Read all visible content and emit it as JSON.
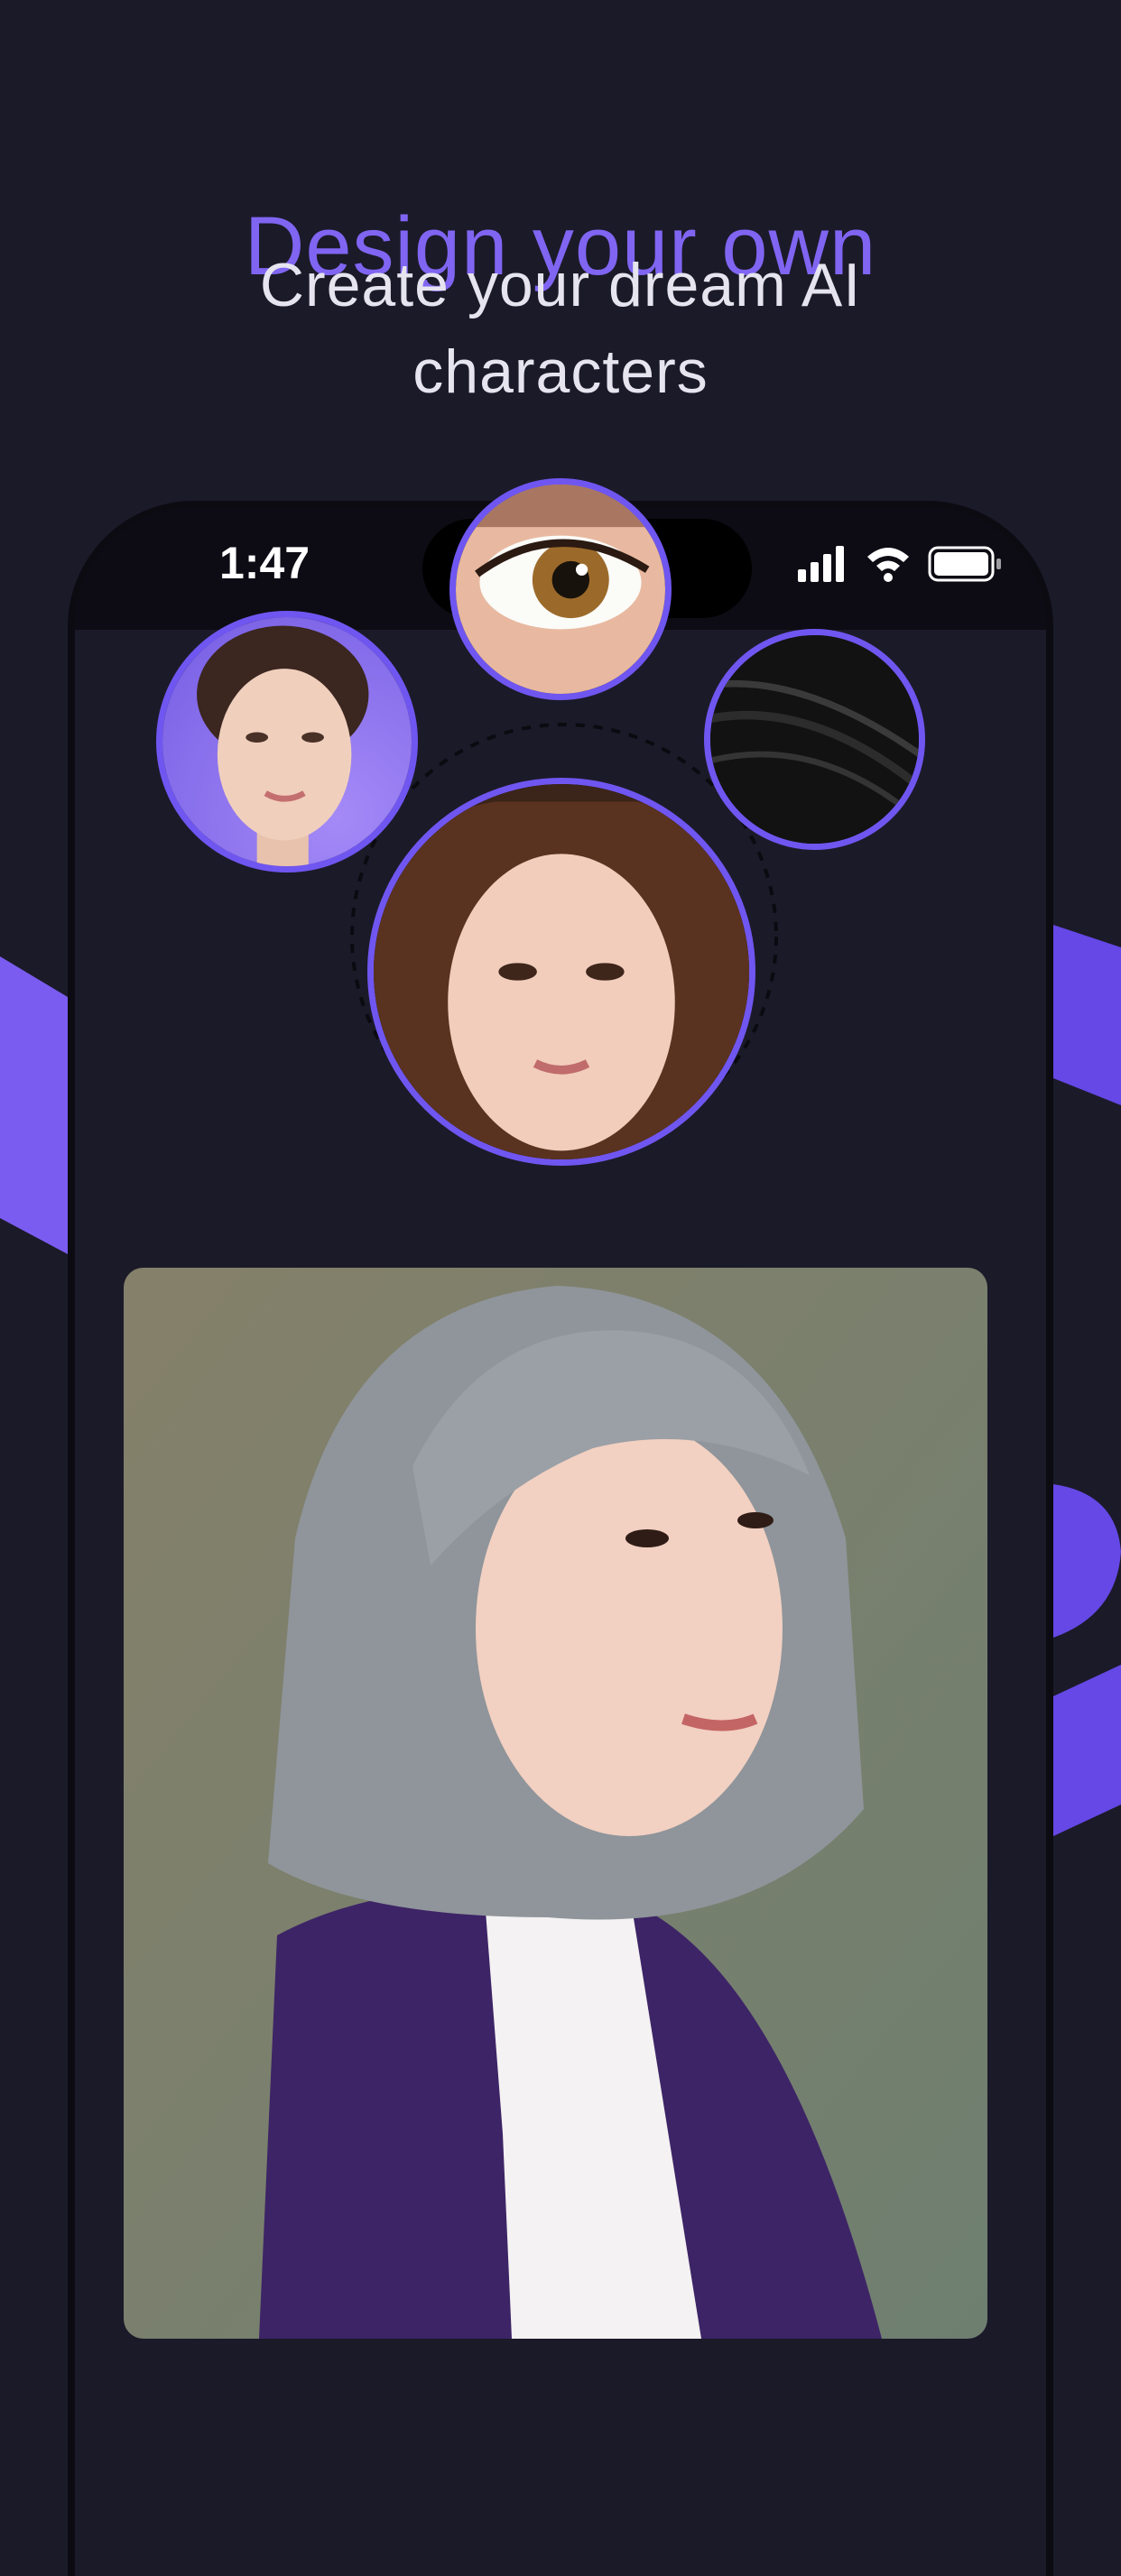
{
  "header": {
    "title": "Design your own",
    "subtitle": "Create your dream AI characters"
  },
  "status_bar": {
    "time": "1:47",
    "signal_icon": "cellular-signal-icon",
    "wifi_icon": "wifi-icon",
    "battery_icon": "battery-icon"
  },
  "features": {
    "items": [
      {
        "name": "face",
        "icon": "face-photo"
      },
      {
        "name": "eye",
        "icon": "eye-photo"
      },
      {
        "name": "hair",
        "icon": "hair-texture-photo"
      },
      {
        "name": "result",
        "icon": "result-face-photo"
      }
    ]
  },
  "preview": {
    "icon": "generated-character-portrait"
  },
  "colors": {
    "background": "#1b1a29",
    "accent": "#7056f0",
    "title": "#8065f2",
    "subtitle": "#e6e4ee"
  }
}
